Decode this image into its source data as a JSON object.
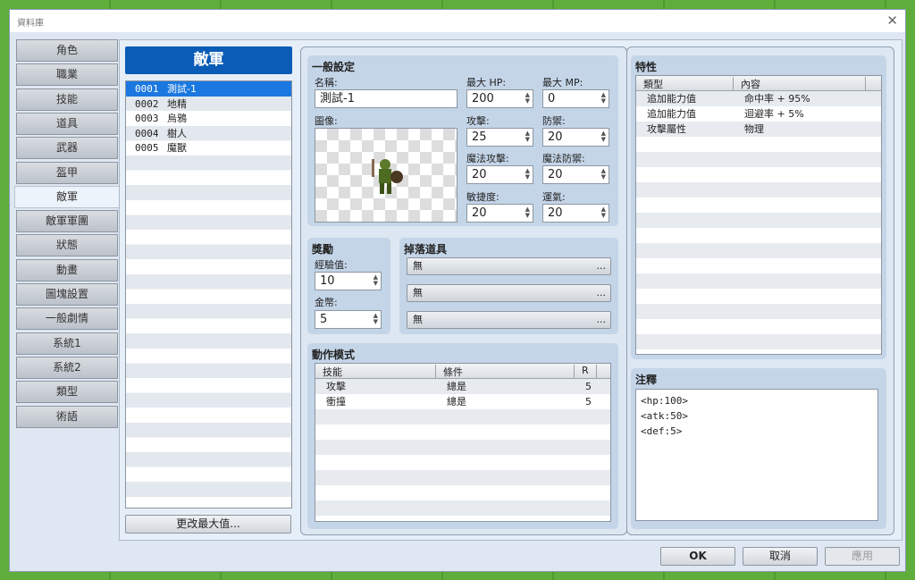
{
  "window": {
    "title": "資料庫",
    "close": "✕"
  },
  "nav": [
    "角色",
    "職業",
    "技能",
    "道具",
    "武器",
    "盔甲",
    "敵軍",
    "敵軍軍團",
    "狀態",
    "動畫",
    "圖塊設置",
    "一般劇情",
    "系統1",
    "系統2",
    "類型",
    "術語"
  ],
  "nav_selected": 6,
  "list": {
    "header": "敵軍",
    "items": [
      {
        "id": "0001",
        "name": "測試-1"
      },
      {
        "id": "0002",
        "name": "地精"
      },
      {
        "id": "0003",
        "name": "烏鴉"
      },
      {
        "id": "0004",
        "name": "樹人"
      },
      {
        "id": "0005",
        "name": "魔獸"
      }
    ],
    "selected": 0,
    "change_max": "更改最大值..."
  },
  "general": {
    "title": "一般設定",
    "name_label": "名稱:",
    "name_value": "測試-1",
    "image_label": "圖像:",
    "stats": [
      {
        "label": "最大 HP:",
        "value": "200"
      },
      {
        "label": "最大 MP:",
        "value": "0"
      },
      {
        "label": "攻擊:",
        "value": "25"
      },
      {
        "label": "防禦:",
        "value": "20"
      },
      {
        "label": "魔法攻擊:",
        "value": "20"
      },
      {
        "label": "魔法防禦:",
        "value": "20"
      },
      {
        "label": "敏捷度:",
        "value": "20"
      },
      {
        "label": "運氣:",
        "value": "20"
      }
    ]
  },
  "rewards": {
    "title": "獎勵",
    "exp_label": "經驗值:",
    "exp_value": "10",
    "gold_label": "金幣:",
    "gold_value": "5"
  },
  "drops": {
    "title": "掉落道具",
    "items": [
      "無",
      "無",
      "無"
    ],
    "dots": "..."
  },
  "actions": {
    "title": "動作模式",
    "columns": [
      "技能",
      "條件",
      "R"
    ],
    "rows": [
      [
        "攻擊",
        "總是",
        "5"
      ],
      [
        "衝撞",
        "總是",
        "5"
      ]
    ]
  },
  "traits": {
    "title": "特性",
    "columns": [
      "類型",
      "內容"
    ],
    "rows": [
      [
        "追加能力值",
        "命中率 + 95%"
      ],
      [
        "追加能力值",
        "迴避率 + 5%"
      ],
      [
        "攻擊屬性",
        "物理"
      ]
    ]
  },
  "note": {
    "title": "注釋",
    "lines": [
      "<hp:100>",
      "<atk:50>",
      "<def:5>"
    ]
  },
  "footer": {
    "ok": "OK",
    "cancel": "取消",
    "apply": "應用"
  }
}
